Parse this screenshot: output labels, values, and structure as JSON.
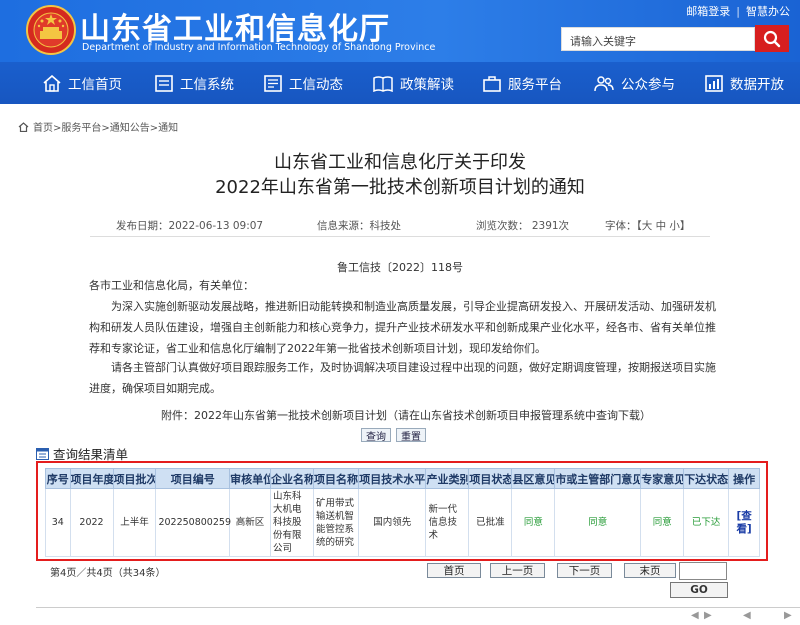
{
  "header": {
    "title": "山东省工业和信息化厅",
    "subtitle": "Department of Industry and Information Technology of Shandong Province",
    "links": [
      "邮箱登录",
      "智慧办公"
    ],
    "search_placeholder": "请输入关键字"
  },
  "nav": [
    {
      "label": "工信首页",
      "icon": "home-icon"
    },
    {
      "label": "工信系统",
      "icon": "system-icon"
    },
    {
      "label": "工信动态",
      "icon": "news-icon"
    },
    {
      "label": "政策解读",
      "icon": "policy-icon"
    },
    {
      "label": "服务平台",
      "icon": "service-icon"
    },
    {
      "label": "公众参与",
      "icon": "people-icon"
    },
    {
      "label": "数据开放",
      "icon": "data-icon"
    }
  ],
  "breadcrumb": "首页>服务平台>通知公告>通知",
  "article": {
    "title_line1": "山东省工业和信息化厅关于印发",
    "title_line2": "2022年山东省第一批技术创新项目计划的通知",
    "publish": "发布日期：2022-06-13 09:07",
    "source": "信息来源：科技处",
    "views": "浏览次数：  2391次",
    "font": "字体：【大 中 小】",
    "doc_no": "鲁工信技〔2022〕118号",
    "greeting": "各市工业和信息化局，有关单位：",
    "p1": "为深入实施创新驱动发展战略，推进新旧动能转换和制造业高质量发展，引导企业提高研发投入、开展研发活动、加强研发机构和研发人员队伍建设，增强自主创新能力和核心竞争力，提升产业技术研发水平和创新成果产业化水平，经各市、省有关单位推荐和专家论证，省工业和信息化厅编制了2022年第一批省技术创新项目计划，现印发给你们。",
    "p2": "请各主管部门认真做好项目跟踪服务工作，及时协调解决项目建设过程中出现的问题，做好定期调度管理，按期报送项目实施进度，确保项目如期完成。",
    "attachment": "附件：2022年山东省第一批技术创新项目计划（请在山东省技术创新项目申报管理系统中查询下载）"
  },
  "query_buttons": [
    "查询",
    "重置"
  ],
  "results": {
    "heading": "查询结果清单",
    "columns": [
      "序号",
      "项目年度",
      "项目批次",
      "项目编号",
      "审核单位",
      "企业名称",
      "项目名称",
      "项目技术水平",
      "产业类别",
      "项目状态",
      "县区意见",
      "市或主管部门意见",
      "专家意见",
      "下达状态",
      "操作"
    ],
    "rows": [
      {
        "no": "34",
        "year": "2022",
        "batch": "上半年",
        "code": "202250800259",
        "unit": "高新区",
        "company": "山东科大机电科技股份有限公司",
        "project": "矿用带式输送机智能管控系统的研究",
        "level": "国内领先",
        "category": "新一代信息技术",
        "status": "已批准",
        "county": "同意",
        "city": "同意",
        "expert": "同意",
        "issued": "已下达",
        "action": "[查看]"
      }
    ]
  },
  "pagination": {
    "info": "第4页／共4页（共34条）",
    "buttons": [
      "首页",
      "上一页",
      "下一页",
      "末页"
    ],
    "go": "GO"
  },
  "colors": {
    "brand_blue": "#1a5fcd",
    "accent_red": "#d71f1f",
    "frame_red": "#e41d1d",
    "ok_green": "#2a9d3a"
  }
}
